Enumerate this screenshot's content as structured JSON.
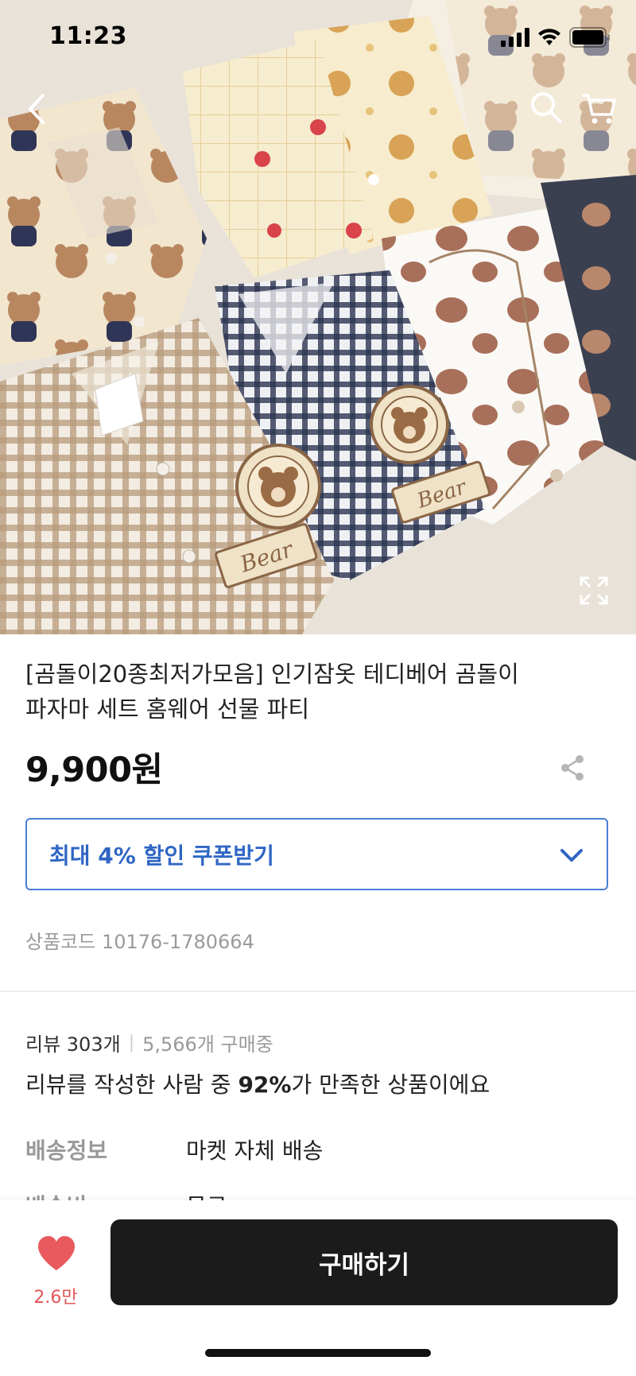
{
  "status_bar": {
    "time": "11:23",
    "icons": [
      "signal-icon",
      "wifi-icon",
      "battery-icon"
    ]
  },
  "nav": {
    "back_icon": "chevron-left-icon",
    "search_icon": "search-icon",
    "cart_icon": "cart-icon",
    "expand_icon": "expand-icon"
  },
  "hero": {
    "prints": [
      "Bear",
      "Bear"
    ]
  },
  "product": {
    "title_line1": "[곰돌이20종최저가모음] 인기잠옷 테디베어 곰돌이",
    "title_line2": "파자마 세트 홈웨어 선물 파티",
    "price": "9,900원",
    "share_icon": "share-icon",
    "coupon_label": "최대 4% 할인 쿠폰받기",
    "coupon_icon": "chevron-down-icon",
    "product_code": "상품코드 10176-1780664"
  },
  "reviews": {
    "review_count": "리뷰 303개",
    "separator": "|",
    "purchase_count": "5,566개 구매중",
    "satisfaction_prefix": "리뷰를 작성한 사람 중 ",
    "satisfaction_percent": "92%",
    "satisfaction_suffix": "가 만족한 상품이에요"
  },
  "shipping": {
    "info_label": "배송정보",
    "info_value": "마켓 자체 배송",
    "fee_label": "배송비",
    "fee_value": "무료"
  },
  "bottom_bar": {
    "like_icon": "heart-icon",
    "like_count": "2.6만",
    "buy_label": "구매하기"
  },
  "colors": {
    "accent_blue": "#2f66c4",
    "heart_red": "#e25558",
    "buy_button": "#1b1b1b"
  }
}
